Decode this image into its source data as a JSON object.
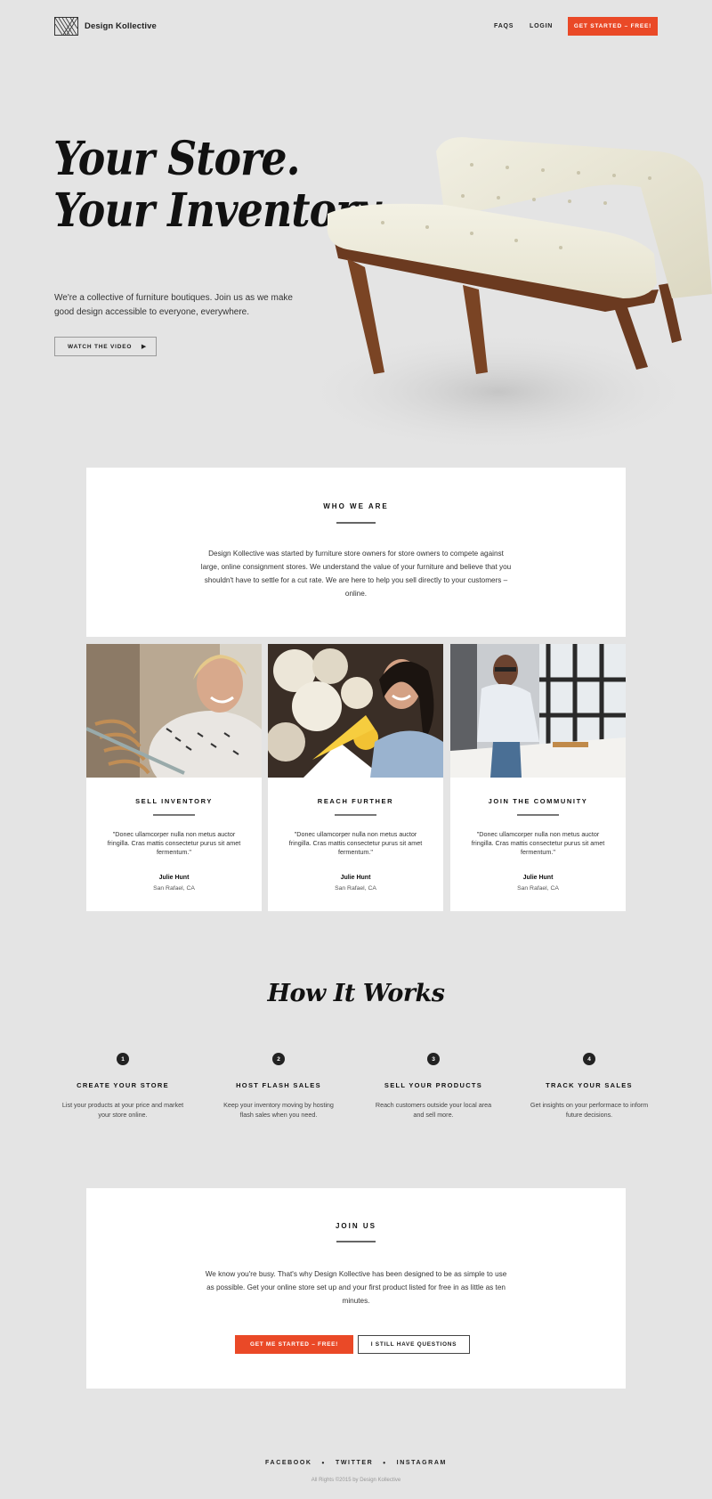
{
  "header": {
    "brand": "Design Kollective",
    "nav": [
      "FAQS",
      "LOGIN"
    ],
    "cta": "GET STARTED – FREE!"
  },
  "hero": {
    "title_line1": "Your Store.",
    "title_line2": "Your Inventory.",
    "text": "We're a collective of furniture boutiques. Join us as we make good design accessible to everyone, everywhere.",
    "video_button": "WATCH THE VIDEO"
  },
  "who": {
    "title": "WHO WE ARE",
    "text": "Design Kollective was started by furniture store owners for store owners to compete against large, online consignment stores. We understand the value of your furniture and believe that you shouldn't have to settle for a cut rate. We are here to help you sell directly to your customers – online."
  },
  "features": [
    {
      "title": "SELL INVENTORY",
      "quote": "\"Donec ullamcorper nulla non metus auctor fringilla. Cras mattis consectetur purus sit amet fermentum.\"",
      "name": "Julie Hunt",
      "location": "San Rafael, CA"
    },
    {
      "title": "REACH FURTHER",
      "quote": "\"Donec ullamcorper nulla non metus auctor fringilla. Cras mattis consectetur purus sit amet fermentum.\"",
      "name": "Julie Hunt",
      "location": "San Rafael, CA"
    },
    {
      "title": "JOIN THE COMMUNITY",
      "quote": "\"Donec ullamcorper nulla non metus auctor fringilla. Cras mattis consectetur purus sit amet fermentum.\"",
      "name": "Julie Hunt",
      "location": "San Rafael, CA"
    }
  ],
  "how": {
    "title": "How It Works",
    "steps": [
      {
        "num": "1",
        "title": "CREATE YOUR STORE",
        "text": "List your products at your price and market your store online."
      },
      {
        "num": "2",
        "title": "HOST FLASH SALES",
        "text": "Keep your inventory moving by hosting flash sales when you need."
      },
      {
        "num": "3",
        "title": "SELL YOUR PRODUCTS",
        "text": "Reach customers outside your local area and sell more."
      },
      {
        "num": "4",
        "title": "TRACK YOUR SALES",
        "text": "Get insights on your performace to inform future decisions."
      }
    ]
  },
  "join": {
    "title": "JOIN US",
    "text": "We know you're busy. That's why Design Kollective has been designed to be as simple to use as possible. Get your online store set up and your first product listed for free in as little as ten minutes.",
    "primary": "GET ME STARTED – FREE!",
    "secondary": "I STILL HAVE QUESTIONS"
  },
  "footer": {
    "links": [
      "FACEBOOK",
      "TWITTER",
      "INSTAGRAM"
    ],
    "copyright": "All Rights ©2015 by Design Kollective"
  },
  "colors": {
    "accent": "#ea4927",
    "background": "#e4e4e4"
  }
}
